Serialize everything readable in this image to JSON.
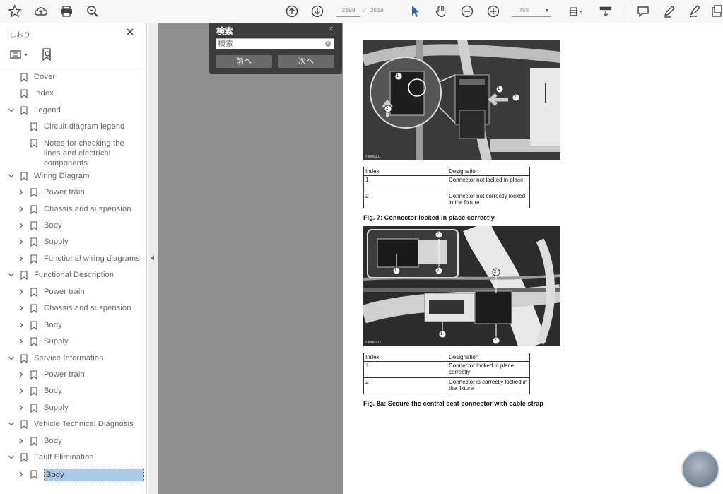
{
  "toolbar": {
    "current_page": "2199",
    "total_pages": "/ 2619",
    "zoom": "75%"
  },
  "sidebar": {
    "title": "しおり",
    "items": [
      {
        "label": "Cover",
        "level": 1,
        "expandable": false
      },
      {
        "label": "Index",
        "level": 1,
        "expandable": false
      },
      {
        "label": "Legend",
        "level": 1,
        "expandable": true,
        "expanded": true
      },
      {
        "label": "Circuit diagram legend",
        "level": 2,
        "expandable": false
      },
      {
        "label": "Notes for checking the lines and electrical components",
        "level": 2,
        "expandable": false
      },
      {
        "label": "Wiring Diagram",
        "level": 1,
        "expandable": true,
        "expanded": true
      },
      {
        "label": "Power train",
        "level": 2,
        "expandable": true
      },
      {
        "label": "Chassis and suspension",
        "level": 2,
        "expandable": true
      },
      {
        "label": "Body",
        "level": 2,
        "expandable": true
      },
      {
        "label": "Supply",
        "level": 2,
        "expandable": true
      },
      {
        "label": "Functional wiring diagrams",
        "level": 2,
        "expandable": true
      },
      {
        "label": "Functional Description",
        "level": 1,
        "expandable": true,
        "expanded": true
      },
      {
        "label": "Power train",
        "level": 2,
        "expandable": true
      },
      {
        "label": "Chassis and suspension",
        "level": 2,
        "expandable": true
      },
      {
        "label": "Body",
        "level": 2,
        "expandable": true
      },
      {
        "label": "Supply",
        "level": 2,
        "expandable": true
      },
      {
        "label": "Service Information",
        "level": 1,
        "expandable": true,
        "expanded": true
      },
      {
        "label": "Power train",
        "level": 2,
        "expandable": true
      },
      {
        "label": "Body",
        "level": 2,
        "expandable": true
      },
      {
        "label": "Supply",
        "level": 2,
        "expandable": true
      },
      {
        "label": "Vehicle Technical Diagnosis",
        "level": 1,
        "expandable": true,
        "expanded": true
      },
      {
        "label": "Body",
        "level": 2,
        "expandable": true
      },
      {
        "label": "Fault Elimination",
        "level": 1,
        "expandable": true,
        "expanded": true
      },
      {
        "label": "Body",
        "level": 2,
        "expandable": true,
        "selected": true
      }
    ]
  },
  "search": {
    "title": "検索",
    "input_value": "検索",
    "prev_label": "前へ",
    "next_label": "次へ"
  },
  "document": {
    "figure1": {
      "photo_id": "P3000001",
      "callouts": [
        "1",
        "2",
        "1",
        "2"
      ],
      "table_headers": [
        "Index",
        "Designation"
      ],
      "rows": [
        {
          "index": "1",
          "designation": "Connector not locked in place"
        },
        {
          "index": "2",
          "designation": "Connector not correctly locked in the fixture"
        }
      ],
      "caption": "Fig. 7: Connector locked in place correctly"
    },
    "figure2": {
      "photo_id": "P3000002",
      "callouts": [
        "2",
        "1",
        "2",
        "2",
        "1",
        "2"
      ],
      "table_headers": [
        "Index",
        "Designation"
      ],
      "rows": [
        {
          "index": "1",
          "designation": "Connector locked in place correctly"
        },
        {
          "index": "2",
          "designation": "Connector is correctly locked in the fixture"
        }
      ],
      "caption": "Fig. 8a: Secure the central seat connector with cable strap"
    }
  }
}
